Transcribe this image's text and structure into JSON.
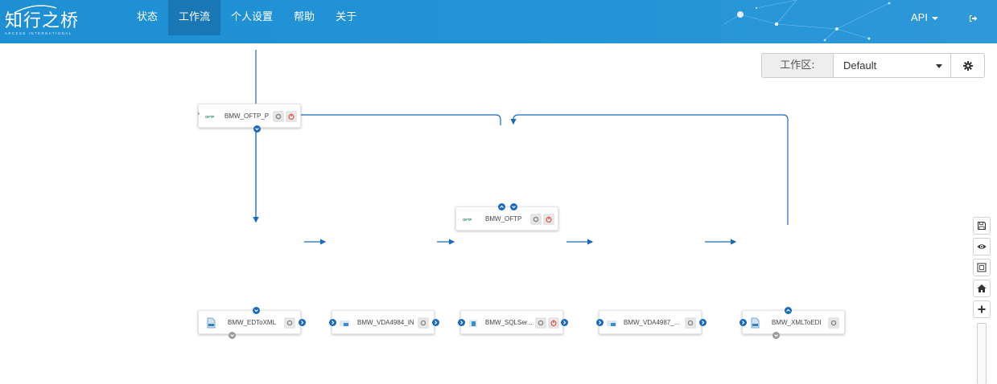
{
  "navbar": {
    "logo_text": "知行之桥",
    "logo_sub": "ARCESB INTERNATIONAL",
    "items": [
      {
        "label": "状态"
      },
      {
        "label": "工作流"
      },
      {
        "label": "个人设置"
      },
      {
        "label": "帮助"
      },
      {
        "label": "关于"
      }
    ],
    "active_index": 1,
    "api_label": "API",
    "logout_icon": "sign-out-icon"
  },
  "workspace": {
    "label": "工作区:",
    "selected": "Default",
    "settings_icon": "gear-icon"
  },
  "flow": {
    "nodes": {
      "oftp_p": {
        "label": "BMW_OFTP_P",
        "icon": "oftp-icon"
      },
      "oftp": {
        "label": "BMW_OFTP",
        "icon": "oftp-icon"
      },
      "edtoxml": {
        "label": "BMW_EDToXML",
        "icon": "xml-file-icon"
      },
      "vda4984": {
        "label": "BMW_VDA4984_IN",
        "icon": "vda-icon"
      },
      "sqlserver": {
        "label": "BMW_SQLSer...",
        "icon": "database-icon"
      },
      "vda4987": {
        "label": "BMW_VDA4987_...",
        "icon": "vda-icon"
      },
      "xmltoedi": {
        "label": "BMW_XMLToEDI",
        "icon": "xml-file-icon"
      }
    }
  },
  "toolbar": {
    "tools": [
      "save-icon",
      "eye-icon",
      "fit-screen-icon",
      "home-icon",
      "plus-icon"
    ]
  },
  "colors": {
    "navbar": "#2394d6",
    "navbar_active": "#1a77b5",
    "edge": "#1a6ab8",
    "port_grey": "#9a9a9a"
  }
}
